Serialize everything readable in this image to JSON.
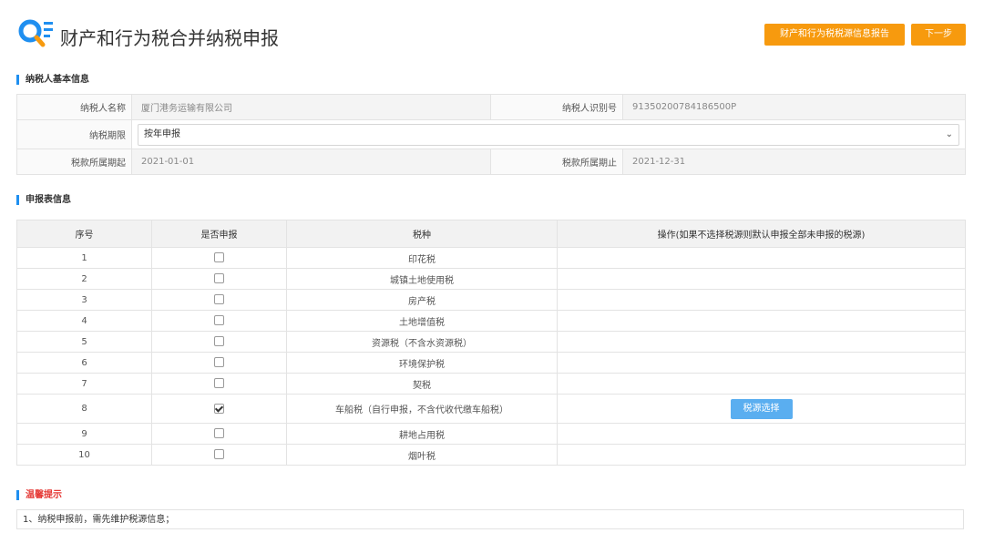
{
  "header": {
    "title": "财产和行为税合并纳税申报",
    "logo_icon": "search-list-icon",
    "report_button": "财产和行为税税源信息报告",
    "next_button": "下一步",
    "accent_color": "#f79a0e"
  },
  "taxpayer_section": {
    "title": "纳税人基本信息",
    "name_label": "纳税人名称",
    "name_value": "厦门港务运输有限公司",
    "id_label": "纳税人识别号",
    "id_value": "91350200784186500P",
    "period_label": "纳税期限",
    "period_value": "按年申报",
    "start_label": "税款所属期起",
    "start_value": "2021-01-01",
    "end_label": "税款所属期止",
    "end_value": "2021-12-31"
  },
  "declaration_section": {
    "title": "申报表信息",
    "columns": [
      "序号",
      "是否申报",
      "税种",
      "操作(如果不选择税源则默认申报全部未申报的税源)"
    ],
    "rows": [
      {
        "no": "1",
        "checked": false,
        "tax": "印花税"
      },
      {
        "no": "2",
        "checked": false,
        "tax": "城镇土地使用税"
      },
      {
        "no": "3",
        "checked": false,
        "tax": "房产税"
      },
      {
        "no": "4",
        "checked": false,
        "tax": "土地增值税"
      },
      {
        "no": "5",
        "checked": false,
        "tax": "资源税（不含水资源税）"
      },
      {
        "no": "6",
        "checked": false,
        "tax": "环境保护税"
      },
      {
        "no": "7",
        "checked": false,
        "tax": "契税"
      },
      {
        "no": "8",
        "checked": true,
        "tax": "车船税（自行申报，不含代收代缴车船税）",
        "action": "税源选择"
      },
      {
        "no": "9",
        "checked": false,
        "tax": "耕地占用税"
      },
      {
        "no": "10",
        "checked": false,
        "tax": "烟叶税"
      }
    ]
  },
  "tips_section": {
    "title": "温馨提示",
    "text": "1、纳税申报前，需先维护税源信息；"
  }
}
